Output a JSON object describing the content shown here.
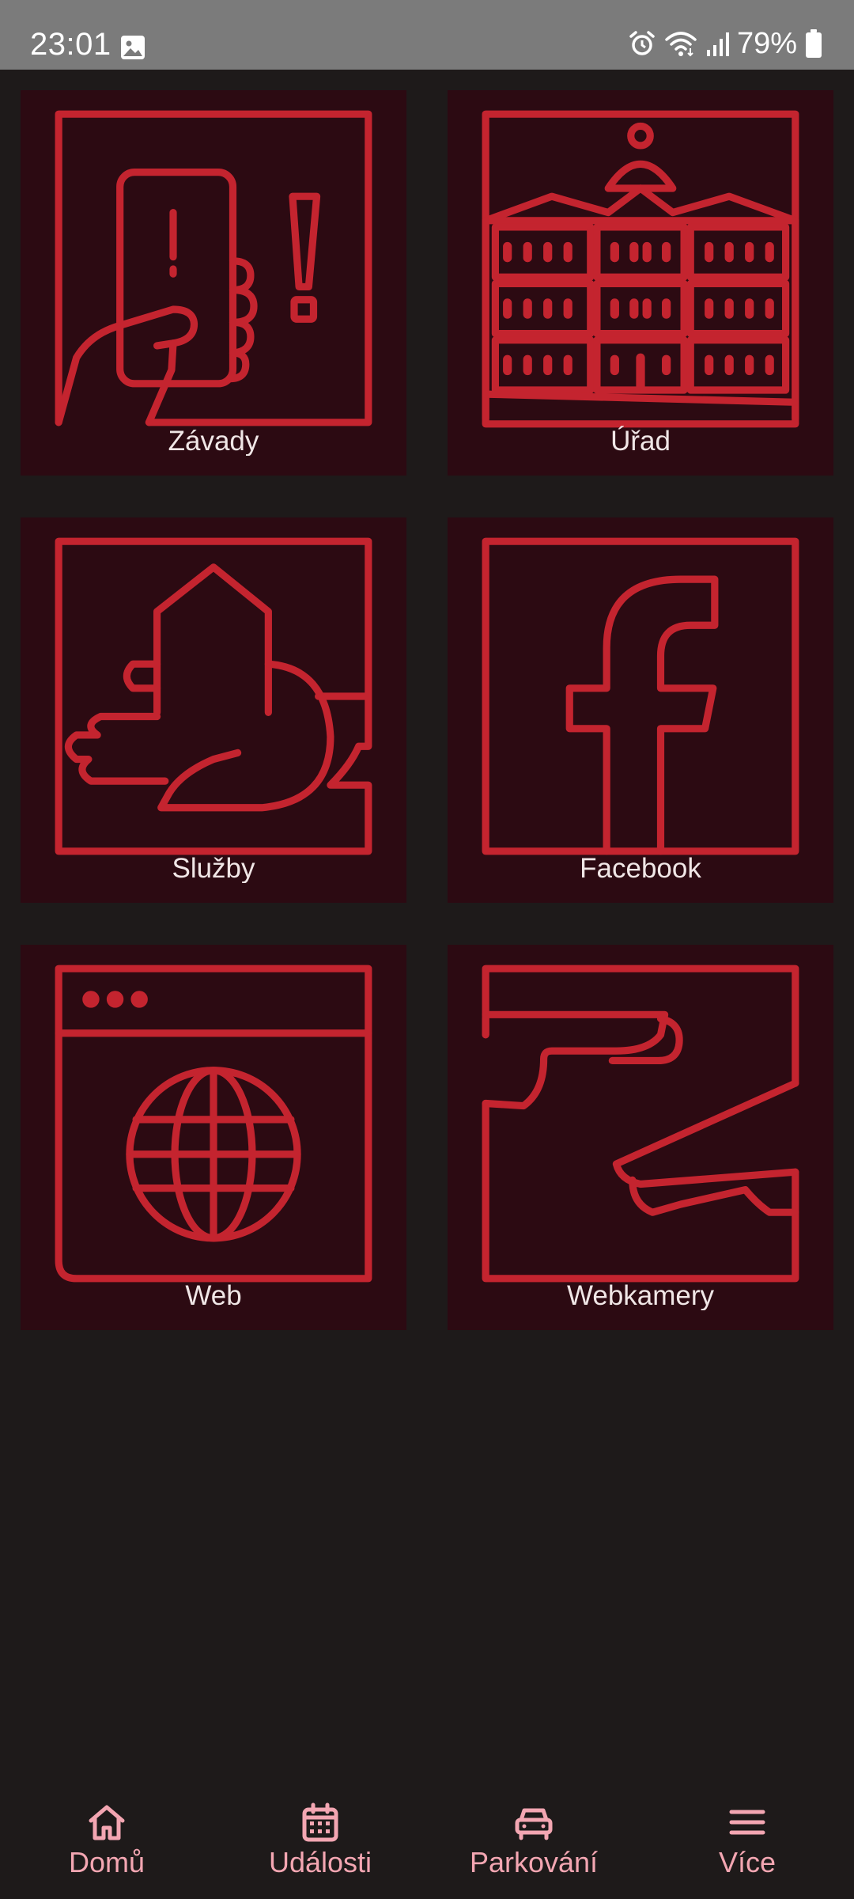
{
  "status_bar": {
    "time": "23:01",
    "battery": "79%",
    "icons": [
      "image-icon",
      "alarm-icon",
      "wifi-icon",
      "signal-icon",
      "battery-icon"
    ]
  },
  "colors": {
    "background": "#1e1a1a",
    "tile_background": "#2c0a12",
    "icon_stroke": "#c4242f",
    "label_text": "#f0e6e6",
    "nav_accent": "#f3a6b2"
  },
  "tiles": [
    {
      "label": "Závady",
      "icon": "phone-alert-icon"
    },
    {
      "label": "Úřad",
      "icon": "town-hall-icon"
    },
    {
      "label": "Služby",
      "icon": "hand-house-icon"
    },
    {
      "label": "Facebook",
      "icon": "facebook-icon"
    },
    {
      "label": "Web",
      "icon": "browser-globe-icon"
    },
    {
      "label": "Webkamery",
      "icon": "security-camera-icon"
    }
  ],
  "bottom_nav": {
    "items": [
      {
        "label": "Domů",
        "icon": "home-icon"
      },
      {
        "label": "Události",
        "icon": "calendar-icon"
      },
      {
        "label": "Parkování",
        "icon": "car-icon"
      },
      {
        "label": "Více",
        "icon": "menu-icon"
      }
    ]
  }
}
